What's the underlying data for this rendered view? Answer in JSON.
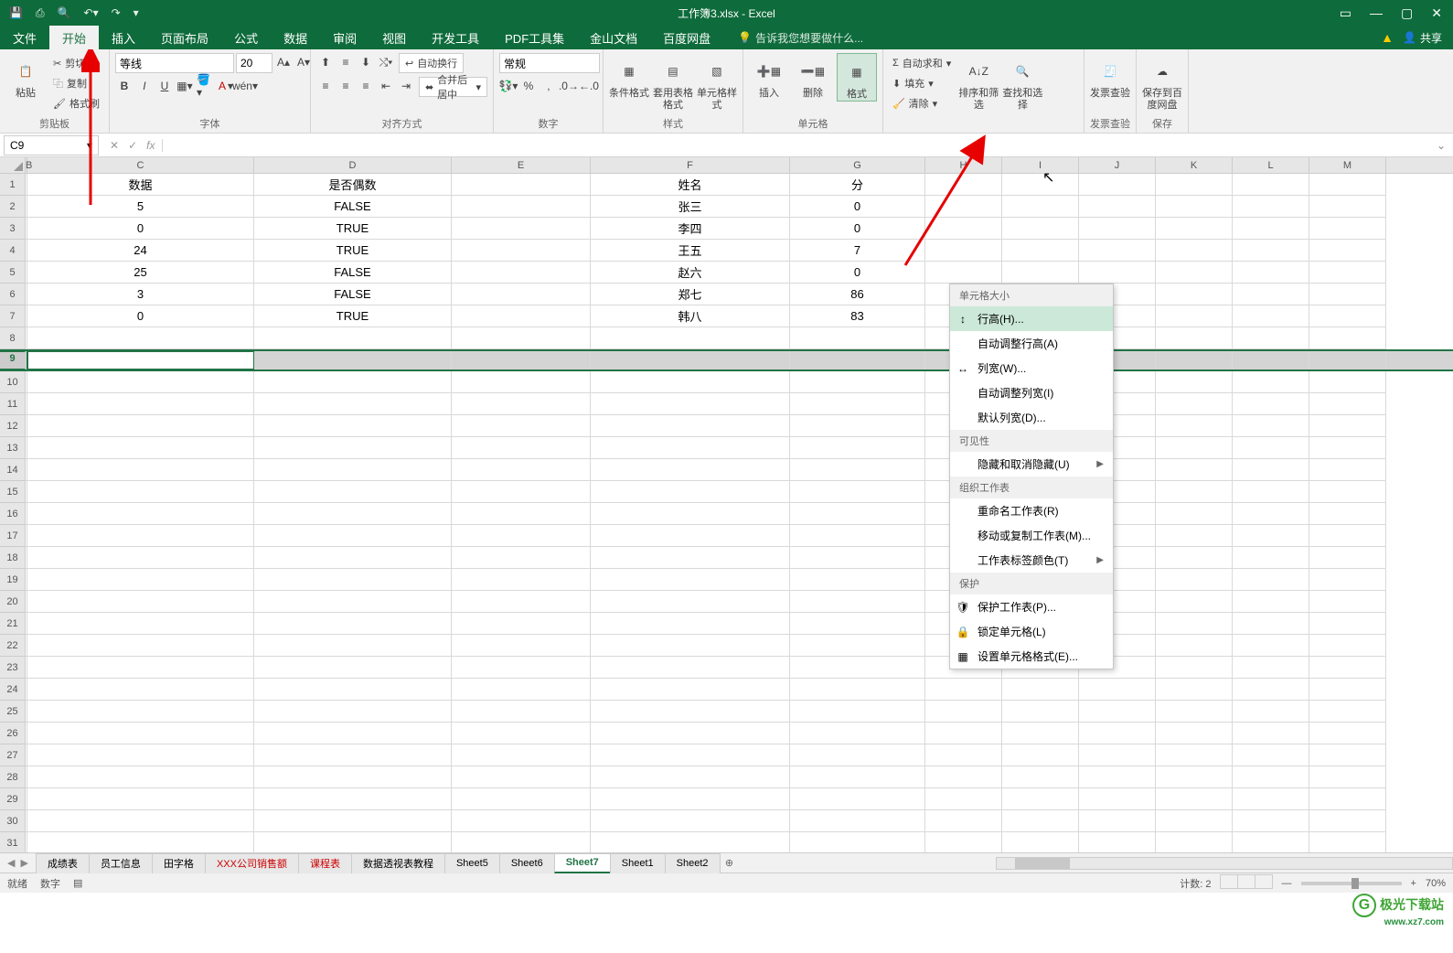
{
  "title": "工作簿3.xlsx - Excel",
  "menutabs": [
    "文件",
    "开始",
    "插入",
    "页面布局",
    "公式",
    "数据",
    "审阅",
    "视图",
    "开发工具",
    "PDF工具集",
    "金山文档",
    "百度网盘"
  ],
  "tellme": "告诉我您想要做什么...",
  "share": "共享",
  "ribbon": {
    "clipboard": {
      "paste": "粘贴",
      "cut": "剪切",
      "copy": "复制",
      "painter": "格式刷",
      "label": "剪贴板"
    },
    "font": {
      "name": "等线",
      "size": "20",
      "label": "字体"
    },
    "align": {
      "wrap": "自动换行",
      "merge": "合并后居中",
      "label": "对齐方式"
    },
    "number": {
      "format": "常规",
      "label": "数字"
    },
    "styles": {
      "cond": "条件格式",
      "table": "套用表格格式",
      "cell": "单元格样式",
      "label": "样式"
    },
    "cells": {
      "insert": "插入",
      "delete": "删除",
      "format": "格式",
      "label": "单元格"
    },
    "editing": {
      "sum": "自动求和",
      "fill": "填充",
      "clear": "清除",
      "sort": "排序和筛选",
      "find": "查找和选择"
    },
    "invoice": {
      "check": "发票查验",
      "label": "发票查验"
    },
    "baidu": {
      "save": "保存到百度网盘",
      "label": "保存"
    }
  },
  "namebox": "C9",
  "cols": [
    "B",
    "C",
    "D",
    "E",
    "F",
    "G",
    "H",
    "I",
    "J",
    "K",
    "L",
    "M"
  ],
  "rowsLabels": [
    "1",
    "2",
    "3",
    "4",
    "5",
    "6",
    "7",
    "8",
    "9",
    "10",
    "11",
    "12",
    "13",
    "14",
    "15",
    "16",
    "17",
    "18",
    "19",
    "20",
    "21",
    "22",
    "23",
    "24",
    "25",
    "26",
    "27",
    "28",
    "29",
    "30",
    "31"
  ],
  "data": {
    "header": {
      "c": "数据",
      "d": "是否偶数",
      "f": "姓名",
      "g": "分"
    },
    "rows": [
      {
        "c": "5",
        "d": "FALSE",
        "f": "张三",
        "g": "0"
      },
      {
        "c": "0",
        "d": "TRUE",
        "f": "李四",
        "g": "0"
      },
      {
        "c": "24",
        "d": "TRUE",
        "f": "王五",
        "g": "7"
      },
      {
        "c": "25",
        "d": "FALSE",
        "f": "赵六",
        "g": "0"
      },
      {
        "c": "3",
        "d": "FALSE",
        "f": "郑七",
        "g": "86"
      },
      {
        "c": "0",
        "d": "TRUE",
        "f": "韩八",
        "g": "83"
      }
    ]
  },
  "context": {
    "h1": "单元格大小",
    "rowheight": "行高(H)...",
    "autorowh": "自动调整行高(A)",
    "colwidth": "列宽(W)...",
    "autocolw": "自动调整列宽(I)",
    "defcolw": "默认列宽(D)...",
    "h2": "可见性",
    "hide": "隐藏和取消隐藏(U)",
    "h3": "组织工作表",
    "rename": "重命名工作表(R)",
    "move": "移动或复制工作表(M)...",
    "tabcolor": "工作表标签颜色(T)",
    "h4": "保护",
    "protect": "保护工作表(P)...",
    "lock": "锁定单元格(L)",
    "fmtcells": "设置单元格格式(E)..."
  },
  "sheets": [
    "成绩表",
    "员工信息",
    "田字格",
    "XXX公司销售额",
    "课程表",
    "数据透视表教程",
    "Sheet5",
    "Sheet6",
    "Sheet7",
    "Sheet1",
    "Sheet2"
  ],
  "activeSheet": "Sheet7",
  "status": {
    "ready": "就绪",
    "num": "数字",
    "scroll": "",
    "count": "计数: 2",
    "zoom": "70%"
  },
  "watermark": {
    "name": "极光下载站",
    "url": "www.xz7.com"
  }
}
